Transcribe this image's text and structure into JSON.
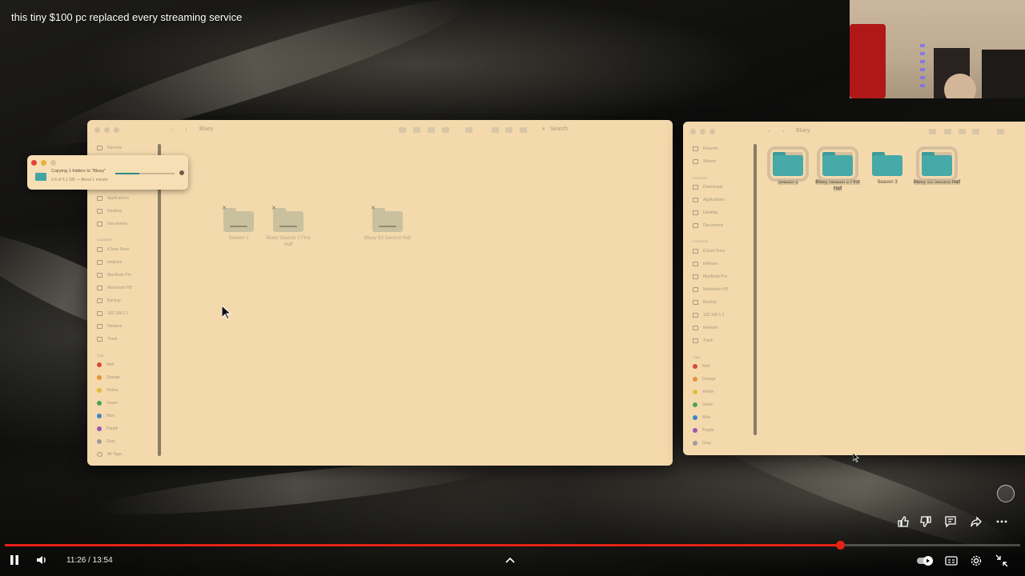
{
  "video": {
    "title": "this tiny $100 pc replaced every streaming service",
    "time_current": "11:26",
    "time_total": "13:54",
    "time_display": "11:26 / 13:54",
    "progress_fraction": 0.8225
  },
  "finder_left": {
    "window_title": "Bluey",
    "search_placeholder": "Search",
    "sidebar": {
      "favorites": [
        "Recents",
        "Shared"
      ],
      "items_a": [
        "Applications",
        "Desktop",
        "Documents"
      ],
      "locations_head": "Locations",
      "locations": [
        "iCloud Drive",
        "bellyson",
        "MacBook Pro",
        "Macintosh HD",
        "Backup",
        "192.168.1.1",
        "Network",
        "Trash"
      ],
      "tags_head": "Tags",
      "tags": [
        {
          "name": "Red",
          "color": "#d44a3c"
        },
        {
          "name": "Orange",
          "color": "#e79337"
        },
        {
          "name": "Yellow",
          "color": "#e0bd3c"
        },
        {
          "name": "Green",
          "color": "#4aa553"
        },
        {
          "name": "Blue",
          "color": "#3c86c4"
        },
        {
          "name": "Purple",
          "color": "#9a58b6"
        },
        {
          "name": "Gray",
          "color": "#9c9c9c"
        },
        {
          "name": "All Tags...",
          "color": "#c4b596"
        }
      ]
    },
    "folders": [
      "Season 1",
      "Bluey Season 2 First Half",
      "Bluey S3 Second Half"
    ]
  },
  "copy_dialog": {
    "title": "Copying 1 folders to “Bluey”",
    "detail": "2.4 of 6.1 GB — About 1 minute",
    "progress_fraction": 0.4
  },
  "finder_right": {
    "window_title": "Bluey",
    "sidebar": {
      "favorites": [
        "Recents",
        "Shared"
      ],
      "items_head": "Favorites",
      "items_a": [
        "Downloads",
        "Applications",
        "Desktop",
        "Documents"
      ],
      "locations_head": "Locations",
      "locations": [
        "iCloud Drive",
        "bellyson",
        "MacBook Pro",
        "Macintosh HD",
        "Backup",
        "192.168.1.1",
        "Network",
        "Trash"
      ],
      "tags_head": "Tags",
      "tags": [
        {
          "name": "Red",
          "color": "#d44a3c"
        },
        {
          "name": "Orange",
          "color": "#e79337"
        },
        {
          "name": "Yellow",
          "color": "#e0bd3c"
        },
        {
          "name": "Green",
          "color": "#4aa553"
        },
        {
          "name": "Blue",
          "color": "#3c86c4"
        },
        {
          "name": "Purple",
          "color": "#9a58b6"
        },
        {
          "name": "Gray",
          "color": "#9c9c9c"
        }
      ]
    },
    "folders": [
      "Season 1",
      "Bluey Season 2 First Half",
      "Season 3",
      "Bluey S3 Second Half"
    ]
  },
  "player_controls": {
    "icons": {
      "pause": "pause-icon",
      "volume": "volume-icon",
      "chevron": "chevron-up-icon",
      "like": "thumbs-up-icon",
      "dislike": "thumbs-down-icon",
      "comment": "comment-icon",
      "share": "share-icon",
      "more": "more-icon",
      "autoplay": "autoplay-toggle-icon",
      "captions": "captions-icon",
      "settings": "gear-icon",
      "exit_fullscreen": "exit-fullscreen-icon"
    },
    "accent": "#e62117"
  }
}
